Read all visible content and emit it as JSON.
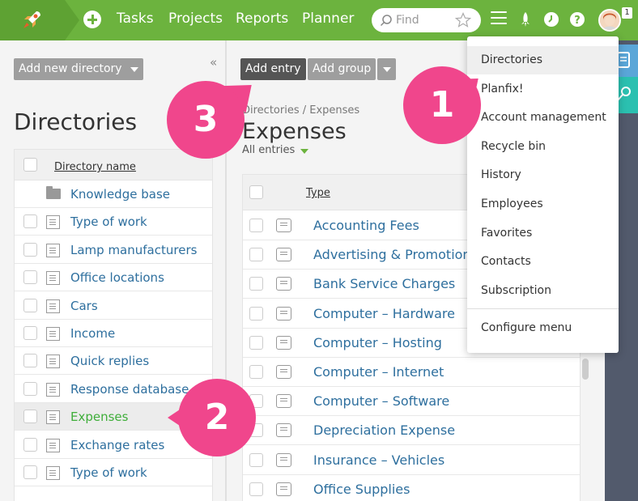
{
  "topbar": {
    "nav": [
      "Tasks",
      "Projects",
      "Reports",
      "Planner"
    ],
    "search_placeholder": "Find",
    "avatar_badge": "1"
  },
  "left_panel": {
    "add_directory_label": "Add new directory",
    "title": "Directories",
    "column_header": "Directory name",
    "items": [
      {
        "label": "Knowledge base",
        "icon": "folder-icon",
        "selected": false
      },
      {
        "label": "Type of work",
        "icon": "document-icon",
        "selected": false
      },
      {
        "label": "Lamp manufacturers",
        "icon": "document-icon",
        "selected": false
      },
      {
        "label": "Office locations",
        "icon": "document-icon",
        "selected": false
      },
      {
        "label": "Cars",
        "icon": "document-icon",
        "selected": false
      },
      {
        "label": "Income",
        "icon": "document-icon",
        "selected": false
      },
      {
        "label": "Quick replies",
        "icon": "document-icon",
        "selected": false
      },
      {
        "label": "Response database",
        "icon": "document-icon",
        "selected": false
      },
      {
        "label": "Expenses",
        "icon": "document-icon",
        "selected": true
      },
      {
        "label": "Exchange rates",
        "icon": "document-icon",
        "selected": false
      },
      {
        "label": "Type of work",
        "icon": "document-icon",
        "selected": false
      }
    ]
  },
  "main_panel": {
    "add_entry_label": "Add entry",
    "add_group_label": "Add group",
    "breadcrumb": "Directories / Expenses",
    "title": "Expenses",
    "filter_label": "All entries",
    "column_header": "Type",
    "rows": [
      "Accounting Fees",
      "Advertising & Promotion",
      "Bank Service Charges",
      "Computer – Hardware",
      "Computer – Hosting",
      "Computer – Internet",
      "Computer – Software",
      "Depreciation Expense",
      "Insurance – Vehicles",
      "Office Supplies"
    ]
  },
  "menu": {
    "items": [
      {
        "label": "Directories",
        "active": true
      },
      {
        "label": "Planfix!",
        "active": false
      },
      {
        "label": "Account management",
        "active": false
      },
      {
        "label": "Recycle bin",
        "active": false
      },
      {
        "label": "History",
        "active": false
      },
      {
        "label": "Employees",
        "active": false
      },
      {
        "label": "Favorites",
        "active": false
      },
      {
        "label": "Contacts",
        "active": false
      },
      {
        "label": "Subscription",
        "active": false
      }
    ],
    "footer_item": "Configure menu"
  },
  "callouts": [
    "1",
    "2",
    "3"
  ],
  "colors": {
    "brand_green": "#6cb33e",
    "link_blue": "#2e6f9e",
    "selected_green": "#3fae3a",
    "callout_pink": "#f0468c"
  }
}
